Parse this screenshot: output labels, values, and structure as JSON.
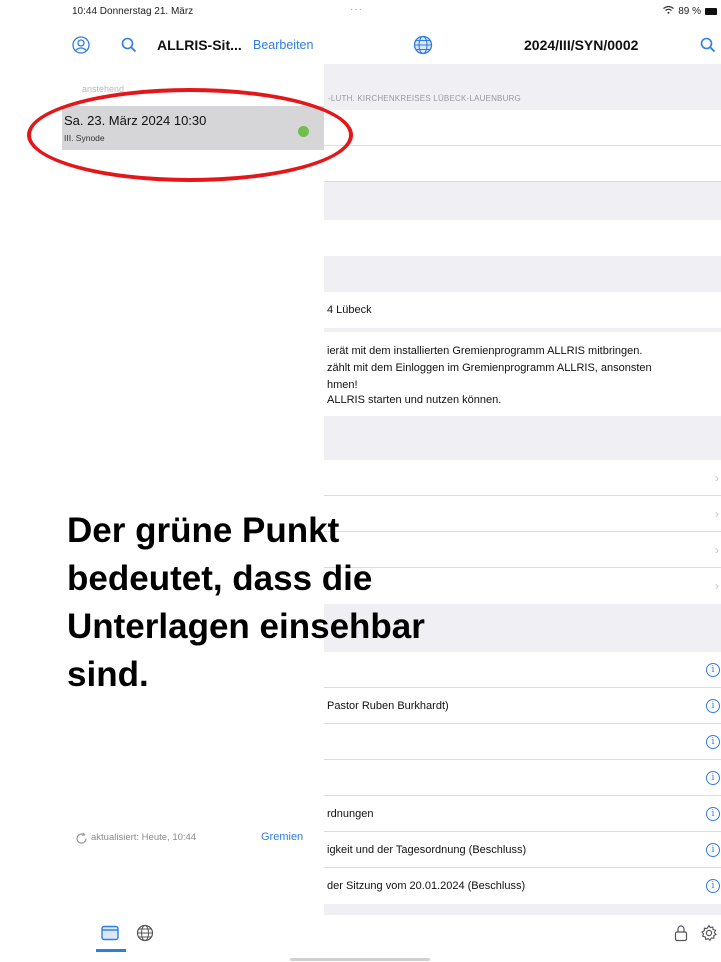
{
  "status_bar": {
    "time": "10:44  Donnerstag 21. März",
    "center_dots": "···",
    "battery": "89 %"
  },
  "sidebar": {
    "title": "ALLRIS-Sit...",
    "edit_label": "Bearbeiten",
    "section_header": "anstehend",
    "meeting": {
      "date": "Sa. 23. März 2024 10:30",
      "body": "III. Synode",
      "status_color": "#6fbf4a"
    },
    "updated_text": "aktualisiert: Heute, 10:44",
    "gremien_label": "Gremien"
  },
  "detail": {
    "title": "2024/III/SYN/0002",
    "org_text": "-LUTH. KIRCHENKREISES LÜBECK-LAUENBURG",
    "location": "4 Lübeck",
    "notes": [
      "ierät mit dem installierten Gremienprogramm ALLRIS mitbringen.",
      "zählt mit dem Einloggen im Gremienprogramm ALLRIS, ansonsten",
      "hmen!",
      "ALLRIS starten und nutzen können."
    ],
    "agenda": [
      "Pastor Ruben Burkhardt)",
      "",
      "",
      "rdnungen",
      "igkeit und der Tagesordnung (Beschluss)",
      "der Sitzung vom 20.01.2024 (Beschluss)"
    ]
  },
  "overlay": {
    "line1": "Der grüne Punkt",
    "line2": "bedeutet, dass die",
    "line3": "Unterlagen einsehbar",
    "line4": "sind."
  },
  "colors": {
    "accent": "#2f7de1",
    "highlight": "#e3161a",
    "status_dot": "#6fbf4a"
  },
  "icons": [
    "profile-icon",
    "search-icon",
    "globe-icon",
    "refresh-icon",
    "calendar-tab-icon",
    "globe-tab-icon",
    "lock-icon",
    "gear-icon",
    "chevron-right-icon",
    "info-icon"
  ]
}
